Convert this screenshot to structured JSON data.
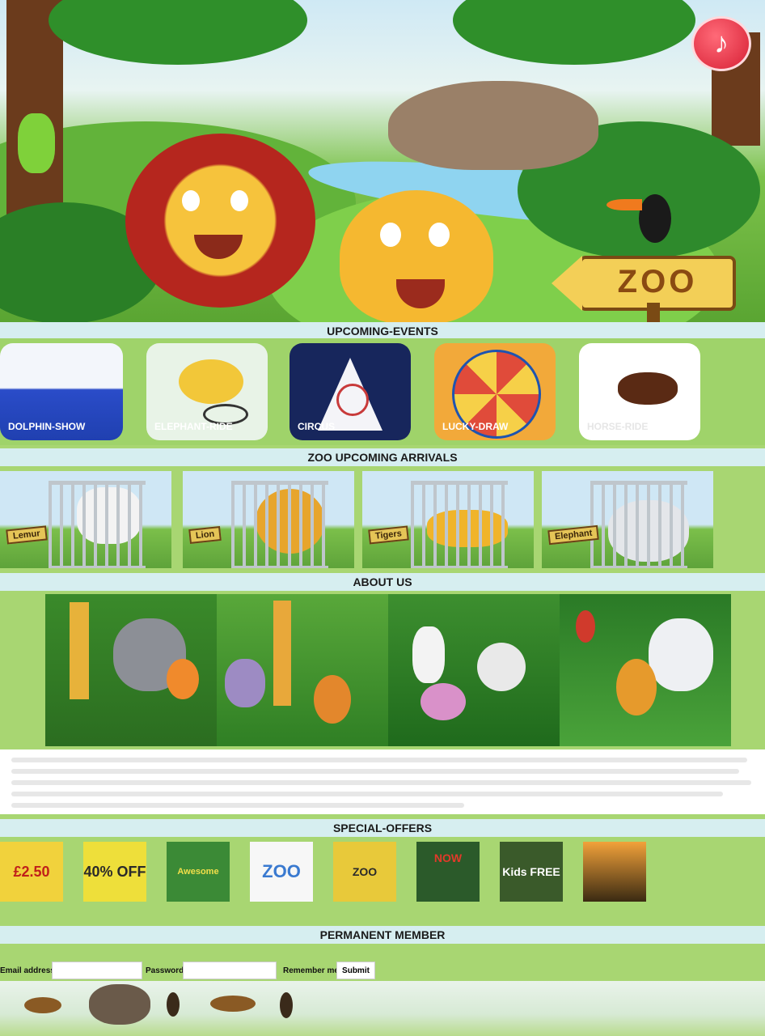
{
  "hero": {
    "sign_text": "ZOO",
    "music_icon": "music-note-icon",
    "colors": {
      "sky": "#cfe9f4",
      "grass": "#5aa532",
      "music": "#d71f34"
    }
  },
  "sections": {
    "events_title": "UPCOMING-EVENTS",
    "arrivals_title": "ZOO UPCOMING ARRIVALS",
    "about_title": "ABOUT US",
    "offers_title": "SPECIAL-OFFERS",
    "member_title": "PERMANENT MEMBER"
  },
  "events": [
    {
      "label": "DOLPHIN-SHOW"
    },
    {
      "label": "ELEPHANT-RIDE"
    },
    {
      "label": "CIRCUS"
    },
    {
      "label": "LUCKY-DRAW"
    },
    {
      "label": "HORSE-RIDE"
    }
  ],
  "arrivals": [
    {
      "tag": "Lemur"
    },
    {
      "tag": "Lion"
    },
    {
      "tag": "Tigers"
    },
    {
      "tag": "Elephant"
    }
  ],
  "offers": [
    {
      "text": "£2.50"
    },
    {
      "text": "40% OFF"
    },
    {
      "text": "Awesome Thursday"
    },
    {
      "text": "ZOO"
    },
    {
      "text": "ZOO TUNES"
    },
    {
      "text": "NOW"
    },
    {
      "text": "Kids FREE"
    },
    {
      "text": ""
    }
  ],
  "member": {
    "email_label": "Email address",
    "password_label": "Password",
    "remember_label": "Remember me",
    "submit_label": "Submit",
    "email_value": "",
    "password_value": ""
  }
}
